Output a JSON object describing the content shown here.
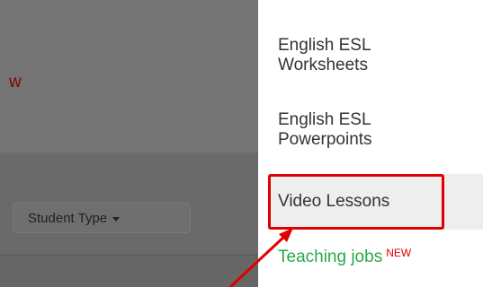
{
  "background": {
    "new_label": "w",
    "filter_button": {
      "label": "Student Type"
    }
  },
  "menu": {
    "items": [
      {
        "label": "English ESL Worksheets"
      },
      {
        "label": "English ESL Powerpoints"
      },
      {
        "label": "Video Lessons"
      },
      {
        "label": "Teaching jobs",
        "badge": "NEW"
      }
    ]
  },
  "colors": {
    "highlight_red": "#e00000",
    "jobs_green": "#2aa84a"
  }
}
